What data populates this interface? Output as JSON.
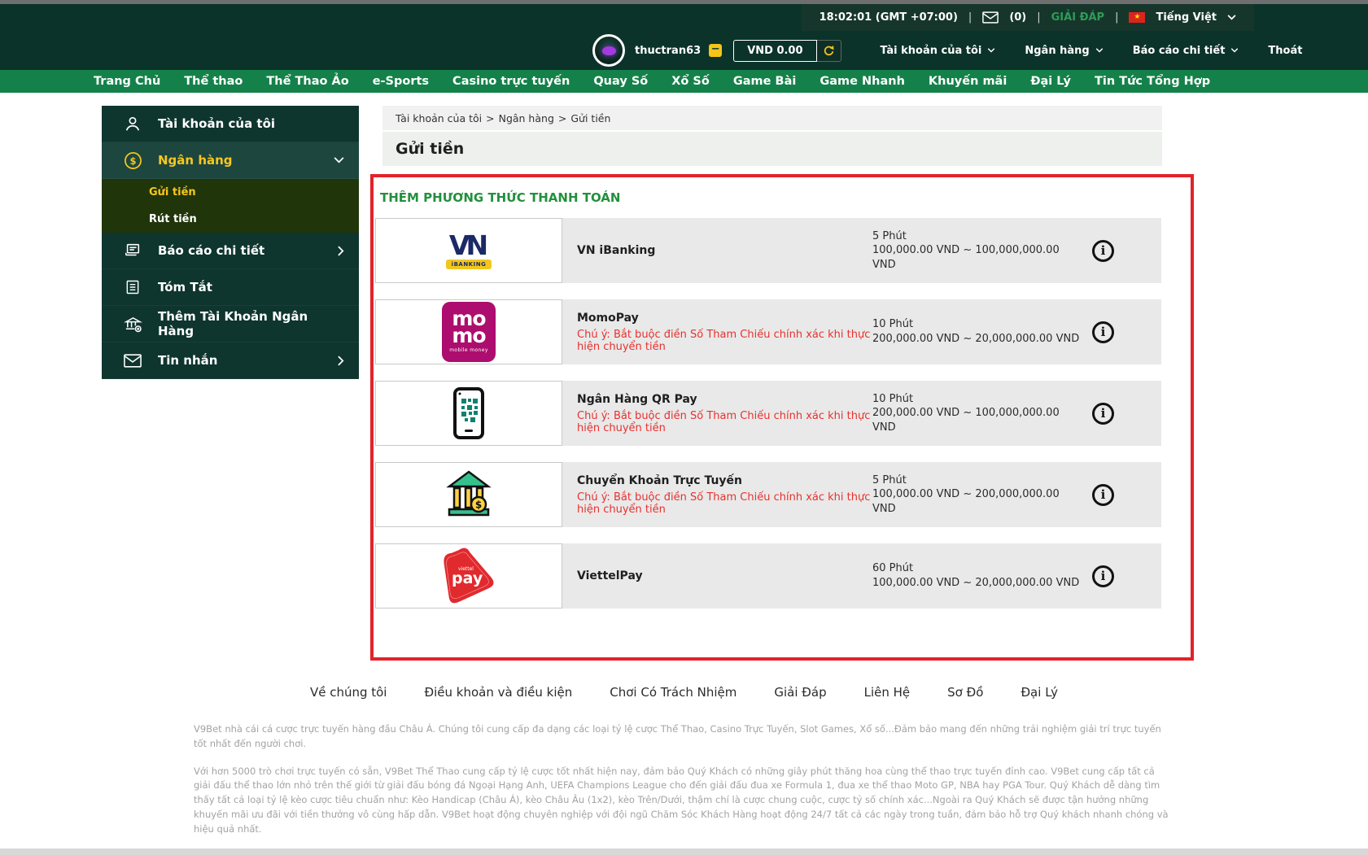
{
  "topbar": {
    "time": "18:02:01 (GMT +07:00)",
    "separator": "|",
    "mail_count": "(0)",
    "faq_label": "GIẢI ĐÁP",
    "flag_star": "★",
    "language_label": "Tiếng Việt"
  },
  "header": {
    "username": "thuctran63",
    "hide_balance_label": "−",
    "balance": "VND 0.00",
    "menu_account": "Tài khoản của tôi",
    "menu_banking": "Ngân hàng",
    "menu_reports": "Báo cáo chi tiết",
    "logout_label": "Thoát"
  },
  "nav": {
    "items": [
      "Trang Chủ",
      "Thể thao",
      "Thể Thao Ảo",
      "e-Sports",
      "Casino trực tuyến",
      "Quay Số",
      "Xổ Số",
      "Game Bài",
      "Game Nhanh",
      "Khuyến mãi",
      "Đại Lý",
      "Tin Tức Tổng Hợp"
    ]
  },
  "sidebar": {
    "account": "Tài khoản của tôi",
    "banking": "Ngân hàng",
    "deposit": "Gửi tiền",
    "withdraw": "Rút tiền",
    "reports": "Báo cáo chi tiết",
    "summary": "Tóm Tắt",
    "add_bank": "Thêm Tài Khoản Ngân Hàng",
    "messages": "Tin nhắn"
  },
  "main": {
    "breadcrumb": {
      "items": [
        "Tài khoản của tôi",
        "Ngân hàng",
        "Gửi tiền"
      ],
      "separator": ">"
    },
    "page_title": "Gửi tiền",
    "section_title": "THÊM PHƯƠNG THỨC THANH TOÁN",
    "methods": [
      {
        "name": "VN iBanking",
        "note": "",
        "time": "5 Phút",
        "limit": "100,000.00 VND ~ 100,000,000.00 VND"
      },
      {
        "name": "MomoPay",
        "note": "Chú ý: Bắt buộc điền Số Tham Chiếu chính xác khi thực hiện chuyển tiền",
        "time": "10 Phút",
        "limit": "200,000.00 VND ~ 20,000,000.00 VND"
      },
      {
        "name": "Ngân Hàng QR Pay",
        "note": "Chú ý: Bắt buộc điền Số Tham Chiếu chính xác khi thực hiện chuyển tiền",
        "time": "10 Phút",
        "limit": "200,000.00 VND ~ 100,000,000.00 VND"
      },
      {
        "name": "Chuyển Khoản Trực Tuyến",
        "note": "Chú ý: Bắt buộc điền Số Tham Chiếu chính xác khi thực hiện chuyển tiền",
        "time": "5 Phút",
        "limit": "100,000.00 VND ~ 200,000,000.00 VND"
      },
      {
        "name": "ViettelPay",
        "note": "",
        "time": "60 Phút",
        "limit": "100,000.00 VND ~ 20,000,000.00 VND"
      }
    ],
    "logos": {
      "vn_letters": "VN",
      "vn_badge": "iBANKING",
      "momo_line1": "mo",
      "momo_line2": "mo",
      "momo_sub": "mobile money",
      "viettel_small": "viettel",
      "viettel_big": "pay"
    },
    "info_glyph": "i"
  },
  "footer": {
    "links": [
      "Về chúng tôi",
      "Điều khoản và điều kiện",
      "Chơi Có Trách Nhiệm",
      "Giải Đáp",
      "Liên Hệ",
      "Sơ Đồ",
      "Đại Lý"
    ],
    "para1": "V9Bet nhà cái cá cược trực tuyến hàng đầu Châu Á. Chúng tôi cung cấp đa dạng các loại tỷ lệ cược Thể Thao, Casino Trực Tuyến, Slot Games, Xổ số...Đảm bảo mang đến những trải nghiệm giải trí trực tuyến tốt nhất đến người chơi.",
    "para2": "Với hơn 5000 trò chơi trực tuyến có sẵn, V9Bet Thể Thao cung cấp tỷ lệ cược tốt nhất hiện nay, đảm bảo Quý Khách có những giây phút thăng hoa cùng thể thao trực tuyến đỉnh cao. V9Bet cung cấp tất cả giải đấu thể thao lớn nhỏ trên thế giới từ giải đấu bóng đá Ngoại Hạng Anh, UEFA Champions League cho đến giải đấu đua xe Formula 1, đua xe thể thao Moto GP, NBA hay PGA Tour. Quý Khách dễ dàng tìm thấy tất cả loại tỷ lệ kèo cược tiêu chuẩn như: Kèo Handicap (Châu Á), kèo Châu Âu (1x2), kèo Trên/Dưới, thậm chí là cược chung cuộc, cược tỷ số chính xác...Ngoài ra Quý Khách sẽ được tận hưởng những khuyến mãi ưu đãi với tiền thưởng vô cùng hấp dẫn. V9Bet hoạt động chuyên nghiệp với đội ngũ Chăm Sóc Khách Hàng hoạt động 24/7 tất cả các ngày trong tuần, đảm bảo hỗ trợ Quý khách nhanh chóng và hiệu quả nhất."
  },
  "colors": {
    "header_bg": "#0b332a",
    "nav_green": "#15814a",
    "accent_yellow": "#f7c71e",
    "highlight_border_red": "#e3222a",
    "note_red": "#e8312e",
    "section_green": "#23903c",
    "momo_magenta": "#ad0d6e",
    "viettel_red": "#e12a2e",
    "row_gray": "#e9e9e9"
  }
}
